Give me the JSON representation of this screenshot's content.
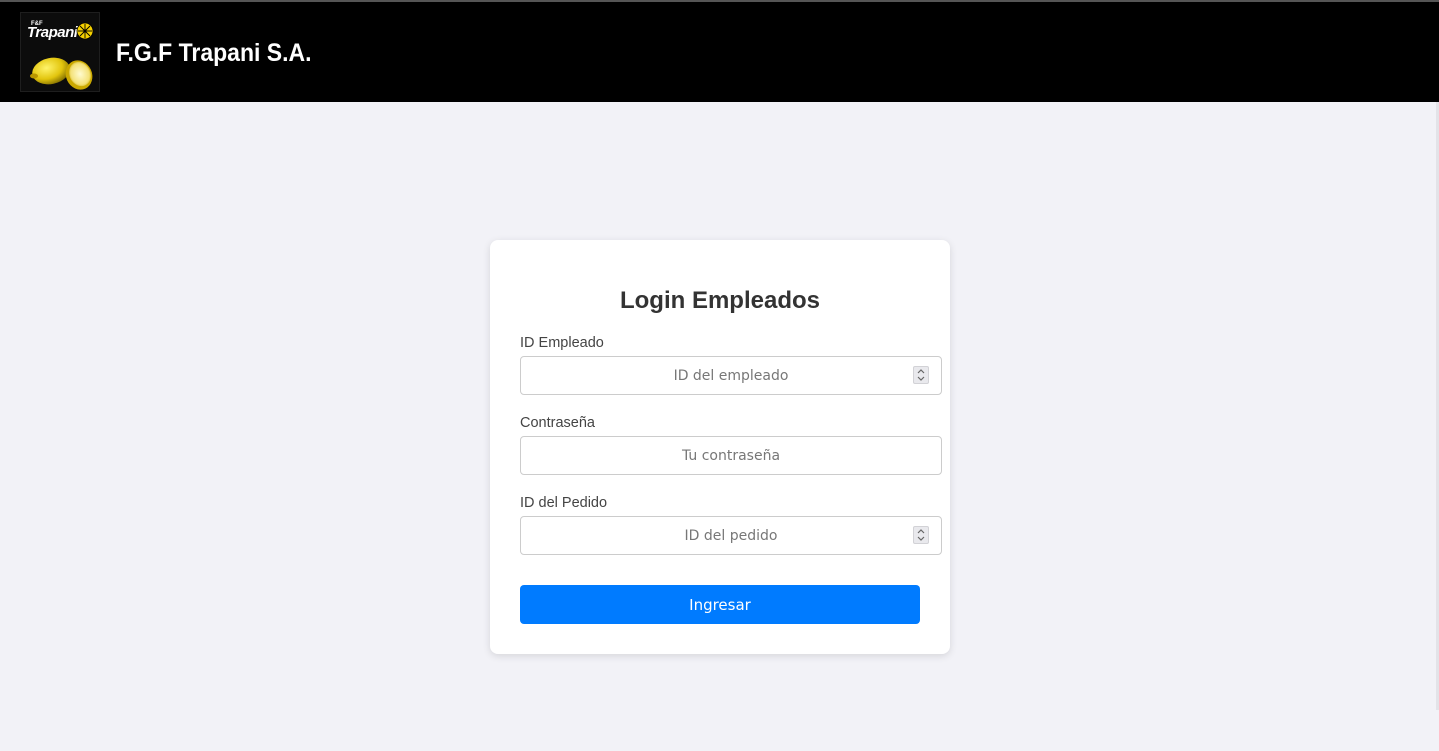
{
  "header": {
    "logo_text": "Trapani",
    "logo_small_text": "F&F",
    "brand_title": "F.G.F Trapani S.A.",
    "background": "#000000"
  },
  "login_card": {
    "title": "Login Empleados",
    "fields": [
      {
        "label": "ID Empleado",
        "placeholder": "ID del empleado",
        "value": "",
        "type": "number"
      },
      {
        "label": "Contraseña",
        "placeholder": "Tu contraseña",
        "value": "",
        "type": "password"
      },
      {
        "label": "ID del Pedido",
        "placeholder": "ID del pedido",
        "value": "",
        "type": "number"
      }
    ],
    "submit_label": "Ingresar",
    "accent_color": "#007bff"
  },
  "icons": {
    "logo": "lemon-logo-icon",
    "spinner": "number-spinner-icon"
  }
}
